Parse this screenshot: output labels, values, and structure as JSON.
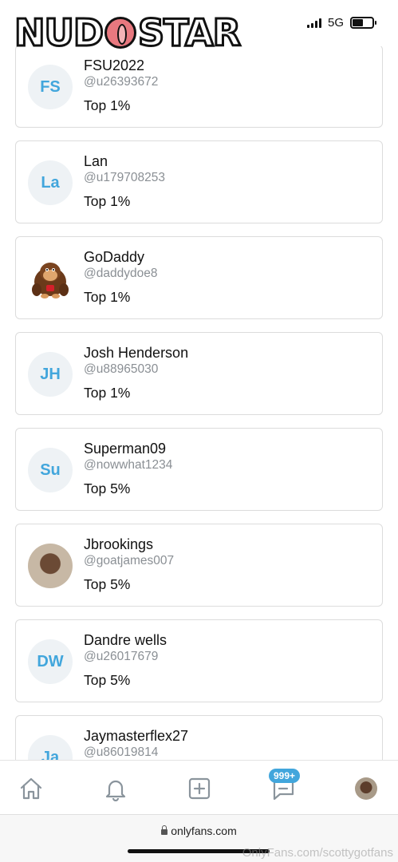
{
  "status_bar": {
    "network": "5G"
  },
  "logo": {
    "text_left": "NUD",
    "text_right": "STAR"
  },
  "users": [
    {
      "initials": "FS",
      "name": "FSU2022",
      "handle": "@u26393672",
      "rank": "Top 1%"
    },
    {
      "initials": "La",
      "name": "Lan",
      "handle": "@u179708253",
      "rank": "Top 1%"
    },
    {
      "initials": "",
      "avatar_image": "donkey-kong",
      "name": "GoDaddy",
      "handle": "@daddydoe8",
      "rank": "Top 1%"
    },
    {
      "initials": "JH",
      "name": "Josh Henderson",
      "handle": "@u88965030",
      "rank": "Top 1%"
    },
    {
      "initials": "Su",
      "name": "Superman09",
      "handle": "@nowwhat1234",
      "rank": "Top 5%"
    },
    {
      "initials": "",
      "avatar_image": "photo",
      "name": "Jbrookings",
      "handle": "@goatjames007",
      "rank": "Top 5%"
    },
    {
      "initials": "DW",
      "name": "Dandre wells",
      "handle": "@u26017679",
      "rank": "Top 5%"
    },
    {
      "initials": "Ja",
      "name": "Jaymasterflex27",
      "handle": "@u86019814",
      "rank": ""
    }
  ],
  "bottom_nav": {
    "items": [
      "home-icon",
      "bell-icon",
      "add-post-icon",
      "messages-icon",
      "profile-avatar"
    ],
    "messages_badge": "999+"
  },
  "browser": {
    "url": "onlyfans.com"
  },
  "watermark": "OnlyFans.com/scottygotfans",
  "colors": {
    "accent": "#42a6dc",
    "avatar_bg": "#eef2f5",
    "handle": "#8a8f94"
  }
}
